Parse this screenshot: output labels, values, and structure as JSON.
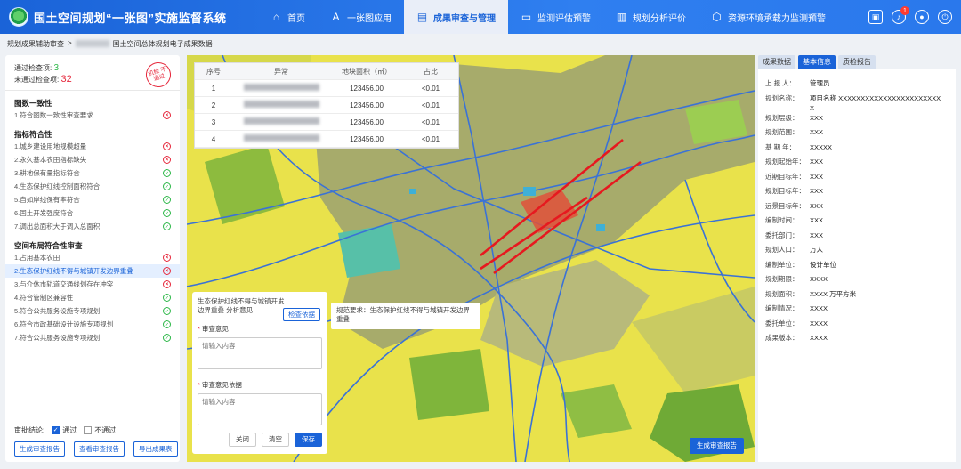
{
  "app": {
    "title": "国土空间规划“一张图”实施监督系统",
    "nav": [
      {
        "label": "首页",
        "icon": "home-icon",
        "glyph": "⌂"
      },
      {
        "label": "一张图应用",
        "icon": "map-layers-icon",
        "glyph": "A"
      },
      {
        "label": "成果审查与管理",
        "icon": "document-icon",
        "glyph": "▤",
        "active": true
      },
      {
        "label": "监测评估预警",
        "icon": "monitor-icon",
        "glyph": "▭"
      },
      {
        "label": "规划分析评价",
        "icon": "book-icon",
        "glyph": "▥"
      },
      {
        "label": "资源环境承载力监测预警",
        "icon": "hexagon-icon",
        "glyph": "⬡"
      }
    ],
    "notification_count": "1"
  },
  "breadcrumb": {
    "root": "规划成果辅助审查",
    "sep": ">",
    "current": "国土空间总体规划电子成果数据"
  },
  "summary": {
    "passed_label": "通过检查项:",
    "passed_value": "3",
    "failed_label": "未通过检查项:",
    "failed_value": "32",
    "stamp": "机检 不通过"
  },
  "check_groups": [
    {
      "title": "图数一致性",
      "items": [
        {
          "label": "1.符合图数一致性审查要求",
          "status": "fail"
        }
      ]
    },
    {
      "title": "指标符合性",
      "items": [
        {
          "label": "1.城乡建设用地规模超量",
          "status": "fail"
        },
        {
          "label": "2.永久基本农田指标缺失",
          "status": "fail"
        },
        {
          "label": "3.耕地保有量指标符合",
          "status": "pass"
        },
        {
          "label": "4.生态保护红线控制面积符合",
          "status": "pass"
        },
        {
          "label": "5.自如岸线保有率符合",
          "status": "pass"
        },
        {
          "label": "6.国土开发强度符合",
          "status": "pass"
        },
        {
          "label": "7.调出总面积大于调入总面积",
          "status": "pass"
        }
      ]
    },
    {
      "title": "空间布局符合性审查",
      "items": [
        {
          "label": "1.占用基本农田",
          "status": "fail"
        },
        {
          "label": "2.生态保护红线不得与城镇开发边界重叠",
          "status": "fail",
          "selected": true
        },
        {
          "label": "3.与介休市轨道交通线划存在冲突",
          "status": "fail"
        },
        {
          "label": "4.符合管制区兼容性",
          "status": "pass"
        },
        {
          "label": "5.符合公共服务设施专项规划",
          "status": "pass"
        },
        {
          "label": "6.符合市政基础设计设施专项规划",
          "status": "pass"
        },
        {
          "label": "7.符合公共服务设施专项规划",
          "status": "pass"
        }
      ]
    }
  ],
  "approval": {
    "label": "审批结论:",
    "pass": "通过",
    "fail": "不通过",
    "pass_checked": true
  },
  "left_buttons": [
    "生成审查报告",
    "查看审查报告",
    "导出成果表"
  ],
  "conflict_table": {
    "headers": [
      "序号",
      "异常",
      "地块面积（㎡）",
      "占比"
    ],
    "rows": [
      [
        "1",
        "",
        "123456.00",
        "<0.01"
      ],
      [
        "2",
        "",
        "123456.00",
        "<0.01"
      ],
      [
        "3",
        "",
        "123456.00",
        "<0.01"
      ],
      [
        "4",
        "",
        "123456.00",
        "<0.01"
      ]
    ]
  },
  "opinion": {
    "title": "生态保护红线不得与城镇开发边界重叠 分析意见",
    "link": "检查依据",
    "field1_label": "审查意见",
    "field1_placeholder": "请输入内容",
    "field2_label": "审查意见依据",
    "field2_placeholder": "请输入内容",
    "buttons": [
      "关闭",
      "清空",
      "保存"
    ]
  },
  "tooltip": "规范要求：生态保护红线不得与城镇开发边界重叠",
  "map_button": "生成审查报告",
  "right_tabs": [
    "成果数据",
    "基本信息",
    "质检报告"
  ],
  "active_right_tab": 1,
  "info": [
    {
      "k": "上 报 人：",
      "v": "管理员"
    },
    {
      "k": "规划名称：",
      "v": "项目名称 XXXXXXXXXXXXXXXXXXXXXXXX"
    },
    {
      "k": "规划层级：",
      "v": "XXX"
    },
    {
      "k": "规划范围：",
      "v": "XXX"
    },
    {
      "k": "基 期 年：",
      "v": "XXXXX"
    },
    {
      "k": "规划起始年：",
      "v": "XXX"
    },
    {
      "k": "近期目标年：",
      "v": "XXX"
    },
    {
      "k": "规划目标年：",
      "v": "XXX"
    },
    {
      "k": "远景目标年：",
      "v": "XXX"
    },
    {
      "k": "编制时间：",
      "v": "XXX"
    },
    {
      "k": "委托部门：",
      "v": "XXX"
    },
    {
      "k": "规划人口：",
      "v": "万人"
    },
    {
      "k": "编制单位：",
      "v": "设计单位"
    },
    {
      "k": "规划期限：",
      "v": "XXXX"
    },
    {
      "k": "规划面积：",
      "v": "XXXX 万平方米"
    },
    {
      "k": "编制情况：",
      "v": "XXXX"
    },
    {
      "k": "委托单位：",
      "v": "XXXX"
    },
    {
      "k": "成果版本：",
      "v": "XXXX"
    }
  ],
  "colors": {
    "primary": "#1a63d8",
    "pass": "#2fb84a",
    "fail": "#e6293d",
    "map_yellow": "#e7e04a"
  }
}
